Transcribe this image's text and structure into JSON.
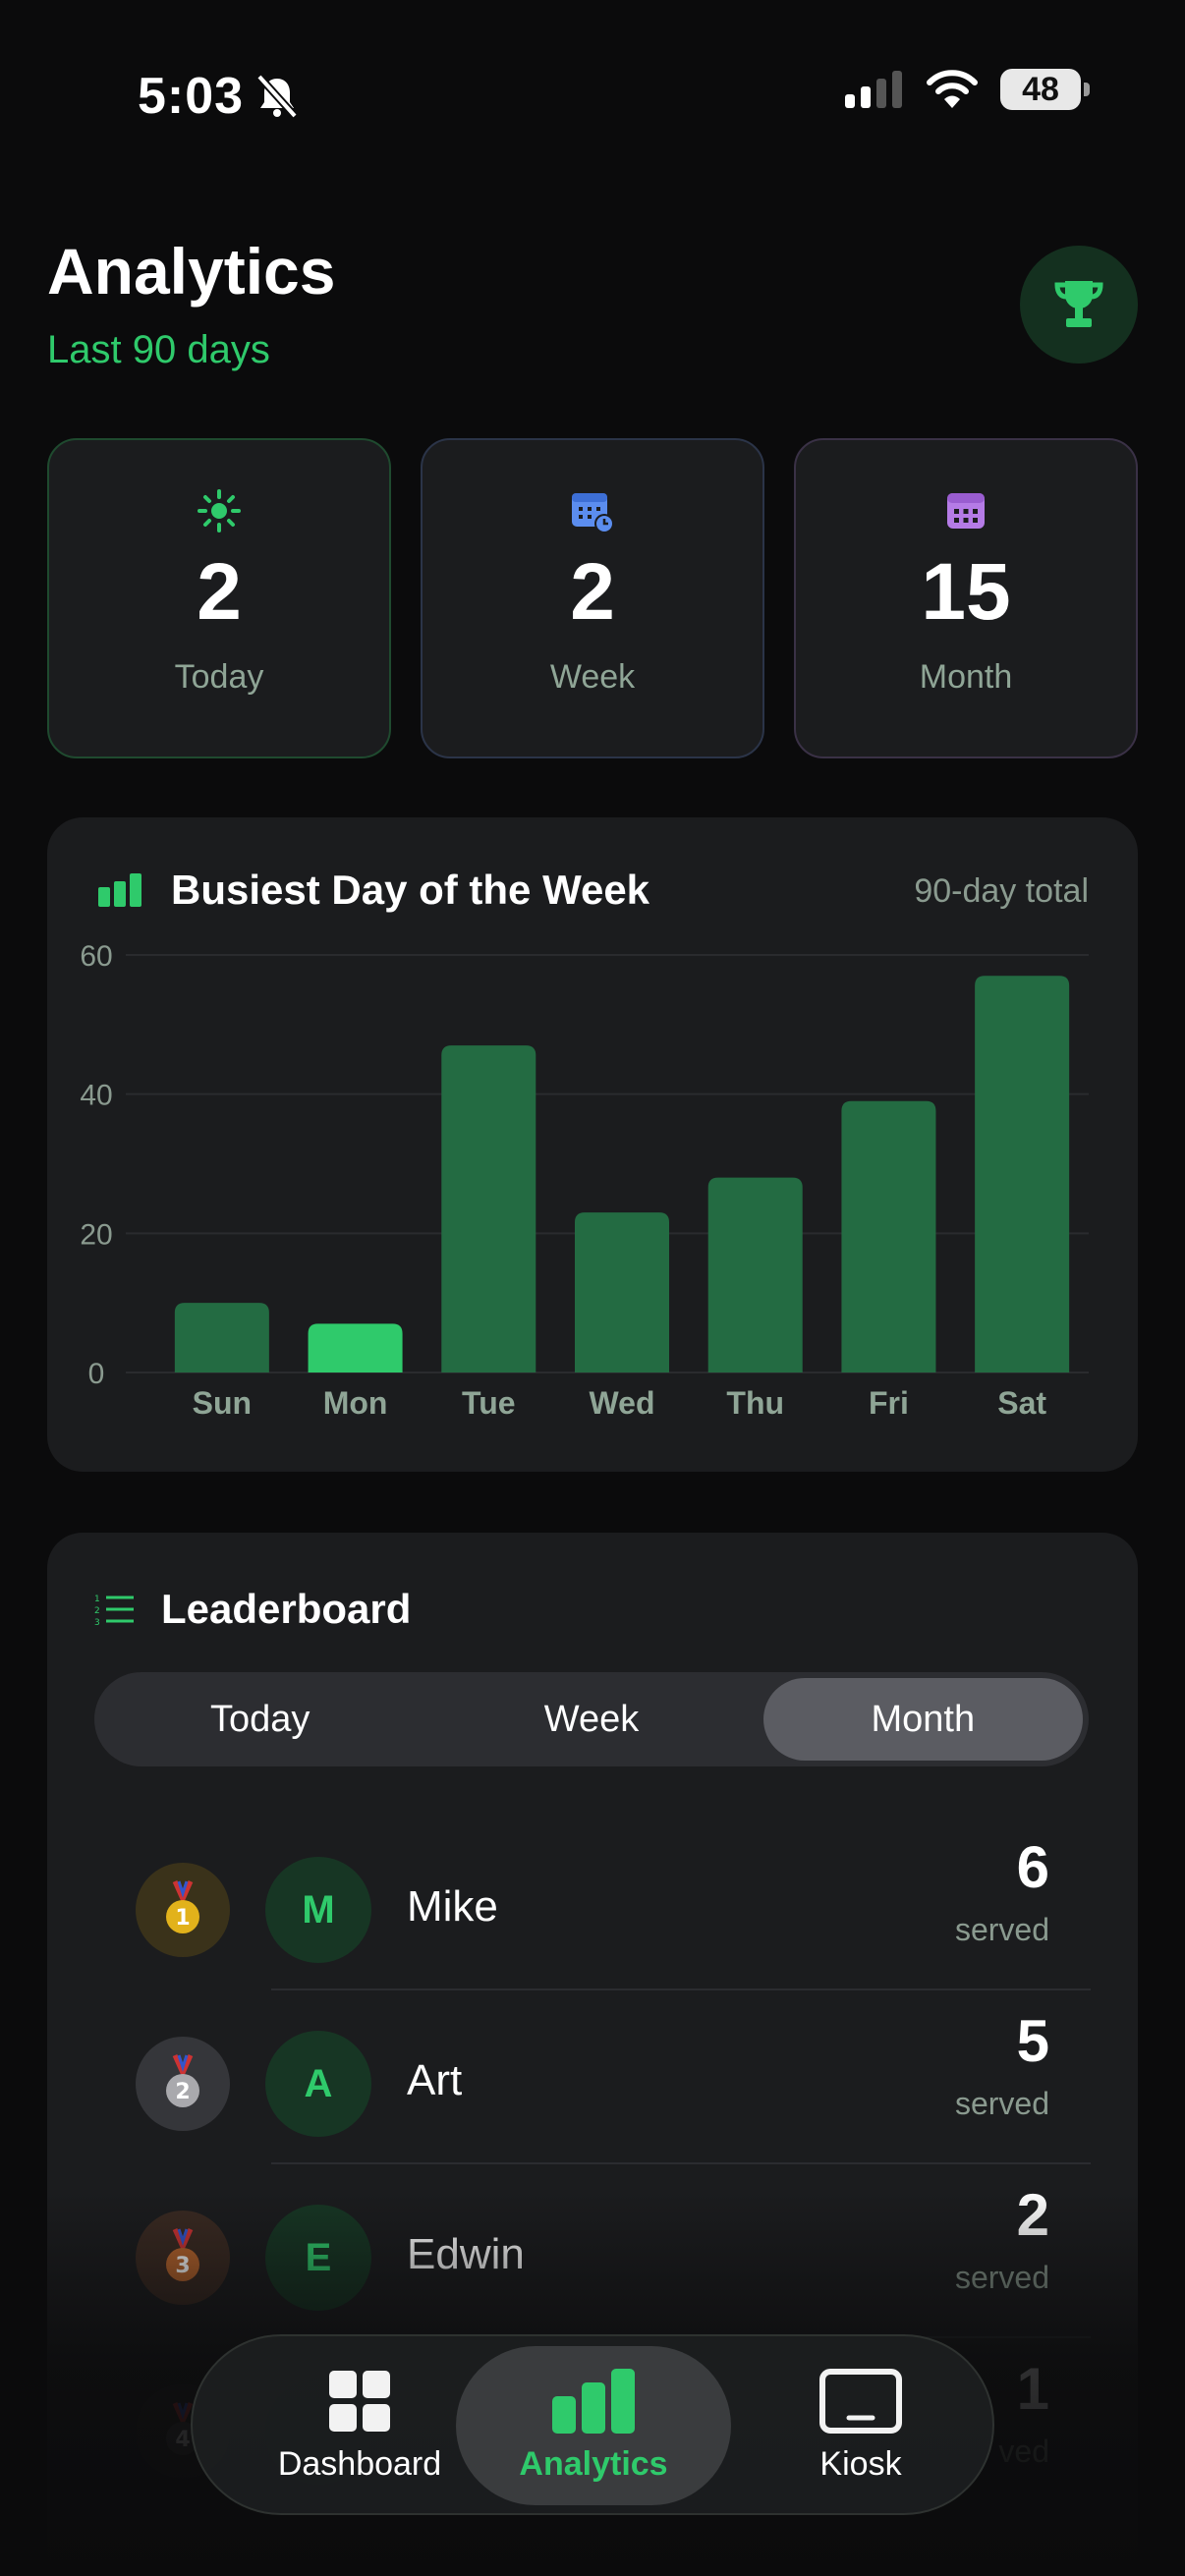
{
  "status": {
    "time": "5:03",
    "battery": "48"
  },
  "header": {
    "title": "Analytics",
    "subtitle": "Last 90 days",
    "trophy_icon": "trophy-icon"
  },
  "stats": [
    {
      "value": "2",
      "label": "Today",
      "icon": "sun-icon",
      "color": "#2fca6b"
    },
    {
      "value": "2",
      "label": "Week",
      "icon": "calendar-clock-icon",
      "color": "#5b8def"
    },
    {
      "value": "15",
      "label": "Month",
      "icon": "calendar-icon",
      "color": "#b57be6"
    }
  ],
  "chart_card": {
    "title": "Busiest Day of the Week",
    "note": "90-day total"
  },
  "chart_data": {
    "type": "bar",
    "categories": [
      "Sun",
      "Mon",
      "Tue",
      "Wed",
      "Thu",
      "Fri",
      "Sat"
    ],
    "values": [
      10,
      7,
      47,
      23,
      28,
      39,
      57
    ],
    "highlight_index": 1,
    "ylim": [
      0,
      60
    ],
    "yticks": [
      0,
      20,
      40,
      60
    ],
    "grid": true,
    "bar_color": "#236b42",
    "highlight_color": "#2fca6b"
  },
  "leaderboard": {
    "title": "Leaderboard",
    "tabs": [
      "Today",
      "Week",
      "Month"
    ],
    "active_tab": "Month",
    "rows": [
      {
        "rank": "1",
        "initial": "M",
        "name": "Mike",
        "count": "6",
        "unit": "served",
        "medal_color": "#e2b21b",
        "medal_bg": "#3a321a"
      },
      {
        "rank": "2",
        "initial": "A",
        "name": "Art",
        "count": "5",
        "unit": "served",
        "medal_color": "#a9a9ad",
        "medal_bg": "#35363a"
      },
      {
        "rank": "3",
        "initial": "E",
        "name": "Edwin",
        "count": "2",
        "unit": "served",
        "medal_color": "#b8652d",
        "medal_bg": "#3a2a22"
      },
      {
        "rank": "4",
        "initial": "",
        "name": "",
        "count": "1",
        "unit": "ved",
        "medal_color": "#444",
        "medal_bg": "#222"
      }
    ]
  },
  "tabbar": {
    "items": [
      {
        "label": "Dashboard",
        "icon": "grid-icon"
      },
      {
        "label": "Analytics",
        "icon": "bar-chart-icon"
      },
      {
        "label": "Kiosk",
        "icon": "tablet-icon"
      }
    ],
    "active": "Analytics"
  }
}
